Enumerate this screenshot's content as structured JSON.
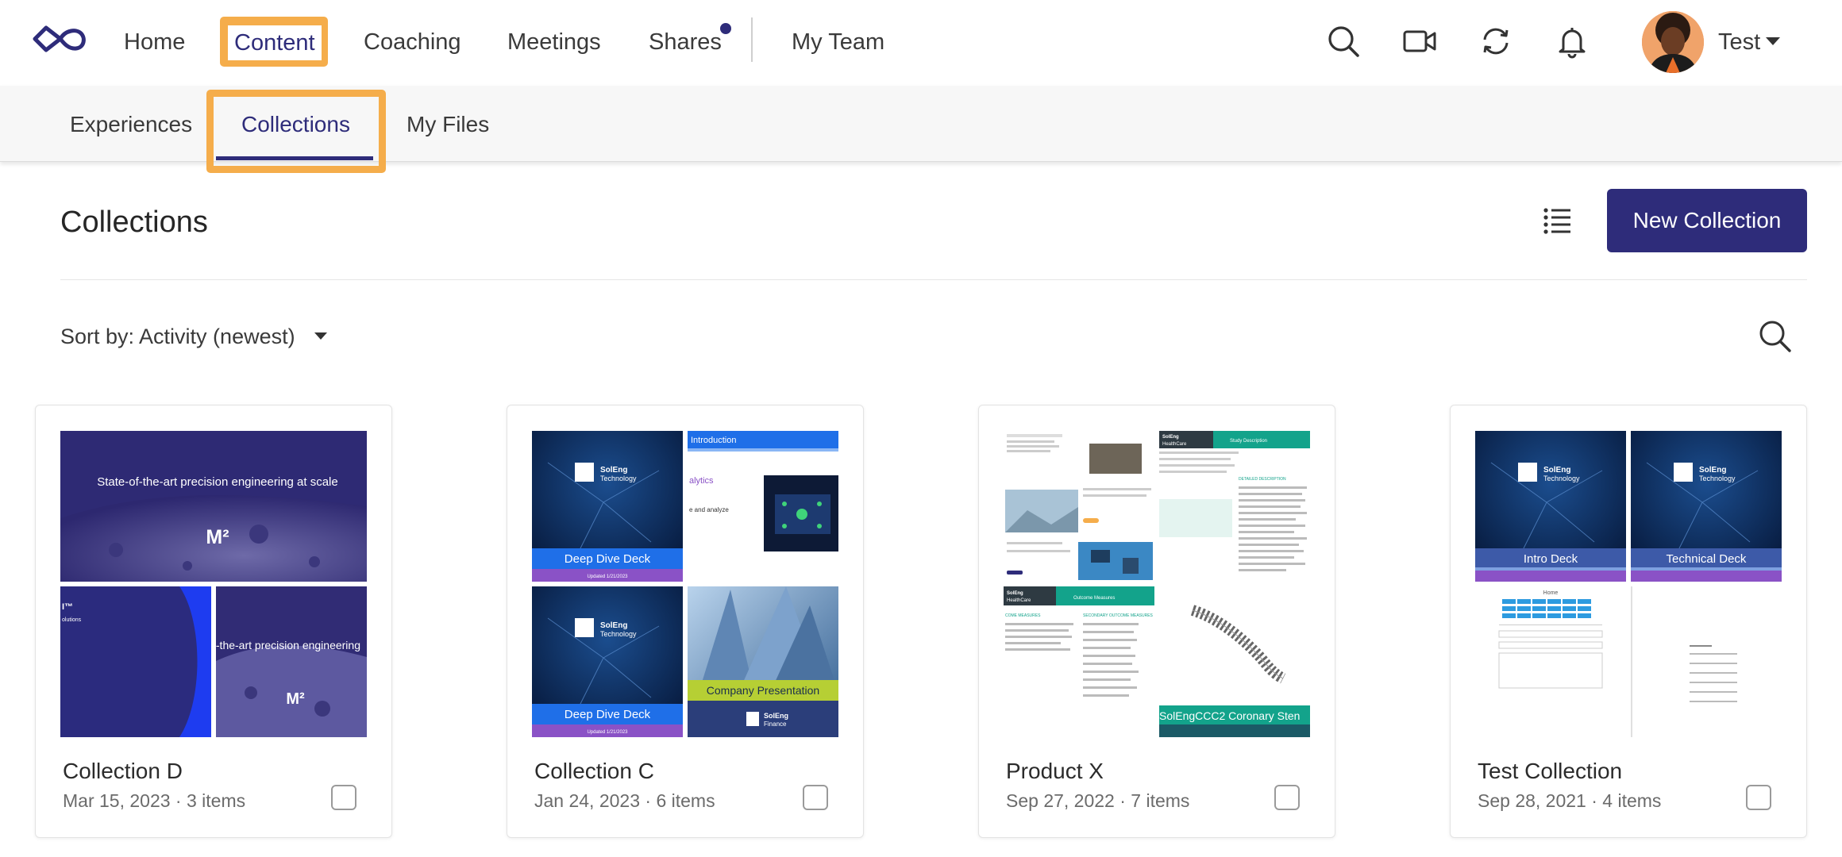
{
  "nav": {
    "items": [
      {
        "label": "Home"
      },
      {
        "label": "Content"
      },
      {
        "label": "Coaching"
      },
      {
        "label": "Meetings"
      },
      {
        "label": "Shares"
      },
      {
        "label": "My Team"
      }
    ],
    "active": "Content",
    "user_name": "Test",
    "icons": [
      "search-icon",
      "video-icon",
      "sync-icon",
      "bell-icon"
    ],
    "accent_color": "#2e2c7a",
    "highlight_color": "#f5ad4b"
  },
  "subnav": {
    "items": [
      {
        "label": "Experiences"
      },
      {
        "label": "Collections"
      },
      {
        "label": "My Files"
      }
    ],
    "active": "Collections"
  },
  "page": {
    "title": "Collections",
    "new_button": "New Collection",
    "sort_label": "Sort by: Activity (newest)"
  },
  "cards": [
    {
      "title": "Collection D",
      "meta": "Mar 15, 2023 · 3 items",
      "thumb_texts": {
        "headline": "State-of-the-art precision engineering at scale",
        "mark": "M²",
        "headline_b": "f-the-art precision engineering",
        "mark_b": "M²",
        "side_a": "I™",
        "side_b": "olutions"
      }
    },
    {
      "title": "Collection C",
      "meta": "Jan 24, 2023 · 6 items",
      "thumb_texts": {
        "brand_a": "SolEng",
        "brand_b": "Technology",
        "deck": "Deep Dive Deck",
        "updated": "Updated 1/21/2023",
        "intro": "Introduction",
        "analytics": "alytics",
        "analyze": "e and analyze",
        "company": "Company Presentation",
        "finance_a": "SolEng",
        "finance_b": "Finance"
      }
    },
    {
      "title": "Product X",
      "meta": "Sep 27, 2022 · 7 items",
      "thumb_texts": {
        "hc_a": "SolEng",
        "hc_b": "HealthCare",
        "study": "Study Description",
        "details": "DETAILED DESCRIPTION",
        "outcome": "Outcome Measures",
        "primary": "COME MEASURES",
        "secondary": "SECONDARY OUTCOME MEASURES",
        "banner": "SolEngCCC2 Coronary Sten"
      }
    },
    {
      "title": "Test Collection",
      "meta": "Sep 28, 2021 · 4 items",
      "thumb_texts": {
        "brand_a": "SolEng",
        "brand_b": "Technology",
        "intro": "Intro Deck",
        "technical": "Technical Deck",
        "home": "Home"
      }
    }
  ]
}
